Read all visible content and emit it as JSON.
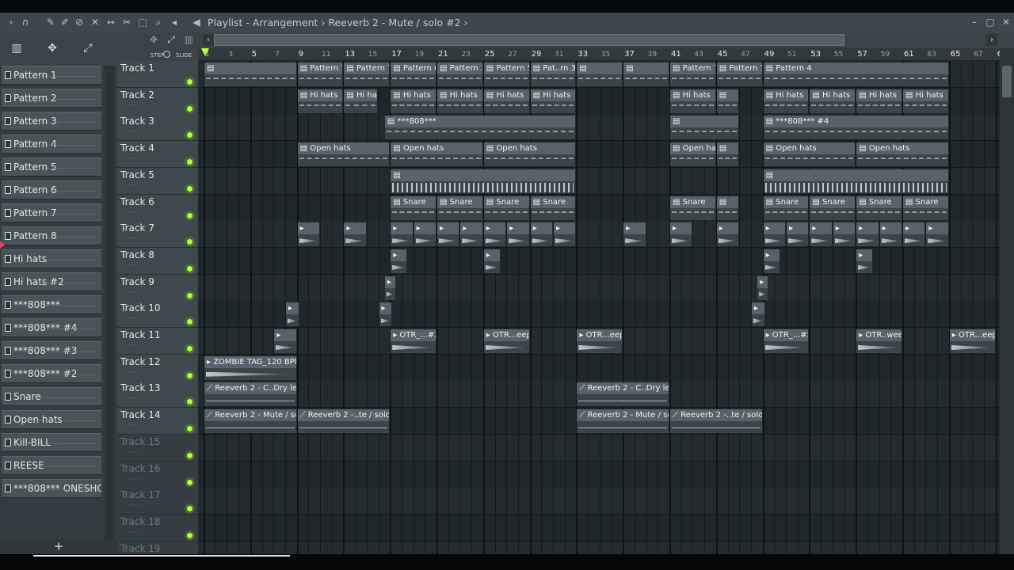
{
  "titlebar": {
    "title": "Playlist - Arrangement › Reeverb 2 - Mute / solo #2 ›",
    "icons": [
      "arrow-right-icon",
      "magnet-icon",
      "pencil-icon",
      "paint-icon",
      "delete-icon",
      "mute-icon",
      "slip-icon",
      "slice-icon",
      "select-icon",
      "zoom-icon",
      "speaker-icon"
    ],
    "window_controls": [
      "minimize-icon",
      "maximize-icon",
      "close-icon"
    ]
  },
  "snap_labels": [
    "STEP",
    "SLIDE"
  ],
  "pattern_browser": {
    "items": [
      {
        "label": "Pattern 1"
      },
      {
        "label": "Pattern 2"
      },
      {
        "label": "Pattern 3"
      },
      {
        "label": "Pattern 4"
      },
      {
        "label": "Pattern 5"
      },
      {
        "label": "Pattern 6"
      },
      {
        "label": "Pattern 7"
      },
      {
        "label": "Pattern 8"
      },
      {
        "label": "Hi hats"
      },
      {
        "label": "Hi hats #2"
      },
      {
        "label": "***808***"
      },
      {
        "label": "***808*** #4"
      },
      {
        "label": "***808*** #3"
      },
      {
        "label": "***808*** #2"
      },
      {
        "label": "Snare"
      },
      {
        "label": "Open hats"
      },
      {
        "label": "Kill-BILL"
      },
      {
        "label": "REESE"
      },
      {
        "label": "***808*** ONESHOT"
      }
    ],
    "selected_index": 6,
    "add_label": "+"
  },
  "ruler": [
    "1",
    "3",
    "5",
    "7",
    "9",
    "11",
    "13",
    "15",
    "17",
    "19",
    "21",
    "23",
    "25",
    "27",
    "29",
    "31",
    "33",
    "35",
    "37",
    "39",
    "41",
    "43",
    "45",
    "47",
    "49",
    "51",
    "53",
    "55",
    "57",
    "59",
    "61",
    "63",
    "65",
    "67",
    "69"
  ],
  "tracks": [
    {
      "name": "Track 1",
      "active": true
    },
    {
      "name": "Track 2",
      "active": true
    },
    {
      "name": "Track 3",
      "active": true
    },
    {
      "name": "Track 4",
      "active": true
    },
    {
      "name": "Track 5",
      "active": true
    },
    {
      "name": "Track 6",
      "active": true
    },
    {
      "name": "Track 7",
      "active": true
    },
    {
      "name": "Track 8",
      "active": true
    },
    {
      "name": "Track 9",
      "active": true
    },
    {
      "name": "Track 10",
      "active": true
    },
    {
      "name": "Track 11",
      "active": true
    },
    {
      "name": "Track 12",
      "active": true
    },
    {
      "name": "Track 13",
      "active": true
    },
    {
      "name": "Track 14",
      "active": true
    },
    {
      "name": "Track 15",
      "active": false
    },
    {
      "name": "Track 16",
      "active": false
    },
    {
      "name": "Track 17",
      "active": false
    },
    {
      "name": "Track 18",
      "active": false
    },
    {
      "name": "Track 19",
      "active": false
    }
  ],
  "clips": [
    {
      "track": 0,
      "start": 1,
      "len": 8,
      "label": "",
      "kind": "pattern"
    },
    {
      "track": 0,
      "start": 9,
      "len": 4,
      "label": "Pattern 7",
      "kind": "pattern"
    },
    {
      "track": 0,
      "start": 13,
      "len": 4,
      "label": "Pattern 7",
      "kind": "pattern"
    },
    {
      "track": 0,
      "start": 17,
      "len": 4,
      "label": "Pattern 6",
      "kind": "pattern"
    },
    {
      "track": 0,
      "start": 21,
      "len": 4,
      "label": "Pattern 3",
      "kind": "pattern"
    },
    {
      "track": 0,
      "start": 25,
      "len": 4,
      "label": "Pattern 5",
      "kind": "pattern"
    },
    {
      "track": 0,
      "start": 29,
      "len": 4,
      "label": "Pat..rn 3",
      "kind": "pattern"
    },
    {
      "track": 0,
      "start": 33,
      "len": 4,
      "label": "",
      "kind": "pattern"
    },
    {
      "track": 0,
      "start": 37,
      "len": 4,
      "label": "",
      "kind": "pattern"
    },
    {
      "track": 0,
      "start": 41,
      "len": 4,
      "label": "Pattern 7",
      "kind": "pattern"
    },
    {
      "track": 0,
      "start": 45,
      "len": 4,
      "label": "Pattern 7",
      "kind": "pattern"
    },
    {
      "track": 0,
      "start": 49,
      "len": 16,
      "label": "Pattern 4",
      "kind": "pattern"
    },
    {
      "track": 1,
      "start": 9,
      "len": 4,
      "label": "Hi hats",
      "kind": "pattern"
    },
    {
      "track": 1,
      "start": 13,
      "len": 3,
      "label": "Hi hats",
      "kind": "pattern"
    },
    {
      "track": 1,
      "start": 17,
      "len": 4,
      "label": "Hi hats",
      "kind": "pattern"
    },
    {
      "track": 1,
      "start": 21,
      "len": 4,
      "label": "Hi hats",
      "kind": "pattern"
    },
    {
      "track": 1,
      "start": 25,
      "len": 4,
      "label": "Hi hats",
      "kind": "pattern"
    },
    {
      "track": 1,
      "start": 29,
      "len": 4,
      "label": "Hi hats",
      "kind": "pattern"
    },
    {
      "track": 1,
      "start": 41,
      "len": 4,
      "label": "Hi hats",
      "kind": "pattern"
    },
    {
      "track": 1,
      "start": 45,
      "len": 2,
      "label": "",
      "kind": "pattern"
    },
    {
      "track": 1,
      "start": 49,
      "len": 4,
      "label": "Hi hats",
      "kind": "pattern"
    },
    {
      "track": 1,
      "start": 53,
      "len": 4,
      "label": "Hi hats",
      "kind": "pattern"
    },
    {
      "track": 1,
      "start": 57,
      "len": 4,
      "label": "Hi hats",
      "kind": "pattern"
    },
    {
      "track": 1,
      "start": 61,
      "len": 4,
      "label": "Hi hats",
      "kind": "pattern"
    },
    {
      "track": 2,
      "start": 16.5,
      "len": 16.5,
      "label": "***808***",
      "kind": "pattern"
    },
    {
      "track": 2,
      "start": 41,
      "len": 6,
      "label": "",
      "kind": "pattern"
    },
    {
      "track": 2,
      "start": 49,
      "len": 16,
      "label": "***808*** #4",
      "kind": "pattern"
    },
    {
      "track": 3,
      "start": 9,
      "len": 8,
      "label": "Open hats",
      "kind": "pattern"
    },
    {
      "track": 3,
      "start": 17,
      "len": 8,
      "label": "Open hats",
      "kind": "pattern"
    },
    {
      "track": 3,
      "start": 25,
      "len": 8,
      "label": "Open hats",
      "kind": "pattern"
    },
    {
      "track": 3,
      "start": 41,
      "len": 4,
      "label": "Open hats",
      "kind": "pattern"
    },
    {
      "track": 3,
      "start": 45,
      "len": 2,
      "label": "",
      "kind": "pattern"
    },
    {
      "track": 3,
      "start": 49,
      "len": 8,
      "label": "Open hats",
      "kind": "pattern"
    },
    {
      "track": 3,
      "start": 57,
      "len": 8,
      "label": "Open hats",
      "kind": "pattern"
    },
    {
      "track": 4,
      "start": 17,
      "len": 16,
      "label": "",
      "kind": "beat"
    },
    {
      "track": 4,
      "start": 49,
      "len": 16,
      "label": "",
      "kind": "beat"
    },
    {
      "track": 5,
      "start": 17,
      "len": 4,
      "label": "Snare",
      "kind": "pattern"
    },
    {
      "track": 5,
      "start": 21,
      "len": 4,
      "label": "Snare",
      "kind": "pattern"
    },
    {
      "track": 5,
      "start": 25,
      "len": 4,
      "label": "Snare",
      "kind": "pattern"
    },
    {
      "track": 5,
      "start": 29,
      "len": 4,
      "label": "Snare",
      "kind": "pattern"
    },
    {
      "track": 5,
      "start": 41,
      "len": 4,
      "label": "Snare",
      "kind": "pattern"
    },
    {
      "track": 5,
      "start": 45,
      "len": 2,
      "label": "",
      "kind": "pattern"
    },
    {
      "track": 5,
      "start": 49,
      "len": 4,
      "label": "Snare",
      "kind": "pattern"
    },
    {
      "track": 5,
      "start": 53,
      "len": 4,
      "label": "Snare",
      "kind": "pattern"
    },
    {
      "track": 5,
      "start": 57,
      "len": 4,
      "label": "Snare",
      "kind": "pattern"
    },
    {
      "track": 5,
      "start": 61,
      "len": 4,
      "label": "Snare",
      "kind": "pattern"
    },
    {
      "track": 6,
      "start": 9,
      "len": 2,
      "label": "",
      "kind": "audio"
    },
    {
      "track": 6,
      "start": 13,
      "len": 2,
      "label": "",
      "kind": "audio"
    },
    {
      "track": 6,
      "start": 17,
      "len": 2,
      "label": "",
      "kind": "audio"
    },
    {
      "track": 6,
      "start": 19,
      "len": 2,
      "label": "",
      "kind": "audio"
    },
    {
      "track": 6,
      "start": 21,
      "len": 2,
      "label": "",
      "kind": "audio"
    },
    {
      "track": 6,
      "start": 23,
      "len": 2,
      "label": "",
      "kind": "audio"
    },
    {
      "track": 6,
      "start": 25,
      "len": 2,
      "label": "",
      "kind": "audio"
    },
    {
      "track": 6,
      "start": 27,
      "len": 2,
      "label": "",
      "kind": "audio"
    },
    {
      "track": 6,
      "start": 29,
      "len": 2,
      "label": "",
      "kind": "audio"
    },
    {
      "track": 6,
      "start": 31,
      "len": 2,
      "label": "",
      "kind": "audio"
    },
    {
      "track": 6,
      "start": 37,
      "len": 2,
      "label": "",
      "kind": "audio"
    },
    {
      "track": 6,
      "start": 41,
      "len": 2,
      "label": "",
      "kind": "audio"
    },
    {
      "track": 6,
      "start": 45,
      "len": 2,
      "label": "",
      "kind": "audio"
    },
    {
      "track": 6,
      "start": 49,
      "len": 2,
      "label": "",
      "kind": "audio"
    },
    {
      "track": 6,
      "start": 51,
      "len": 2,
      "label": "",
      "kind": "audio"
    },
    {
      "track": 6,
      "start": 53,
      "len": 2,
      "label": "",
      "kind": "audio"
    },
    {
      "track": 6,
      "start": 55,
      "len": 2,
      "label": "",
      "kind": "audio"
    },
    {
      "track": 6,
      "start": 57,
      "len": 2,
      "label": "",
      "kind": "audio"
    },
    {
      "track": 6,
      "start": 59,
      "len": 2,
      "label": "",
      "kind": "audio"
    },
    {
      "track": 6,
      "start": 61,
      "len": 2,
      "label": "",
      "kind": "audio"
    },
    {
      "track": 6,
      "start": 63,
      "len": 2,
      "label": "",
      "kind": "audio"
    },
    {
      "track": 7,
      "start": 17,
      "len": 1.5,
      "label": "",
      "kind": "audio"
    },
    {
      "track": 7,
      "start": 25,
      "len": 1.5,
      "label": "",
      "kind": "audio"
    },
    {
      "track": 7,
      "start": 49,
      "len": 1.5,
      "label": "",
      "kind": "audio"
    },
    {
      "track": 7,
      "start": 57,
      "len": 1.5,
      "label": "",
      "kind": "audio"
    },
    {
      "track": 8,
      "start": 16.5,
      "len": 1,
      "label": "",
      "kind": "audio"
    },
    {
      "track": 8,
      "start": 48.5,
      "len": 1,
      "label": "",
      "kind": "audio"
    },
    {
      "track": 9,
      "start": 8,
      "len": 1.2,
      "label": "",
      "kind": "audio"
    },
    {
      "track": 9,
      "start": 16,
      "len": 1.2,
      "label": "",
      "kind": "audio"
    },
    {
      "track": 9,
      "start": 48,
      "len": 1.2,
      "label": "",
      "kind": "audio"
    },
    {
      "track": 10,
      "start": 7,
      "len": 2,
      "label": "",
      "kind": "audio"
    },
    {
      "track": 10,
      "start": 17,
      "len": 4,
      "label": "OTR_...#2",
      "kind": "audio"
    },
    {
      "track": 10,
      "start": 25,
      "len": 4,
      "label": "OTR...eep",
      "kind": "audio"
    },
    {
      "track": 10,
      "start": 33,
      "len": 4,
      "label": "OTR...eep",
      "kind": "audio"
    },
    {
      "track": 10,
      "start": 49,
      "len": 4,
      "label": "OTR_...#2",
      "kind": "audio"
    },
    {
      "track": 10,
      "start": 57,
      "len": 4,
      "label": "OTR..weep",
      "kind": "audio"
    },
    {
      "track": 10,
      "start": 65,
      "len": 4,
      "label": "OTR...eep",
      "kind": "audio"
    },
    {
      "track": 11,
      "start": 1,
      "len": 8,
      "label": "ZOMBIE TAG_120 BPM",
      "kind": "audio"
    },
    {
      "track": 12,
      "start": 1,
      "len": 8,
      "label": "Reeverb 2 - C..Dry level",
      "kind": "auto"
    },
    {
      "track": 12,
      "start": 33,
      "len": 8,
      "label": "Reeverb 2 - C..Dry level",
      "kind": "auto"
    },
    {
      "track": 13,
      "start": 1,
      "len": 8,
      "label": "Reeverb 2 - Mute / solo",
      "kind": "auto"
    },
    {
      "track": 13,
      "start": 9,
      "len": 8,
      "label": "Reeverb 2 -..te / solo #2",
      "kind": "auto"
    },
    {
      "track": 13,
      "start": 33,
      "len": 8,
      "label": "Reeverb 2 - Mute / solo",
      "kind": "auto"
    },
    {
      "track": 13,
      "start": 41,
      "len": 8,
      "label": "Reeverb 2 -..te / solo #2",
      "kind": "auto"
    }
  ],
  "colors": {
    "accent": "#b6ff44",
    "selected_marker": "#e0405a",
    "clip_header": "#57636a"
  }
}
